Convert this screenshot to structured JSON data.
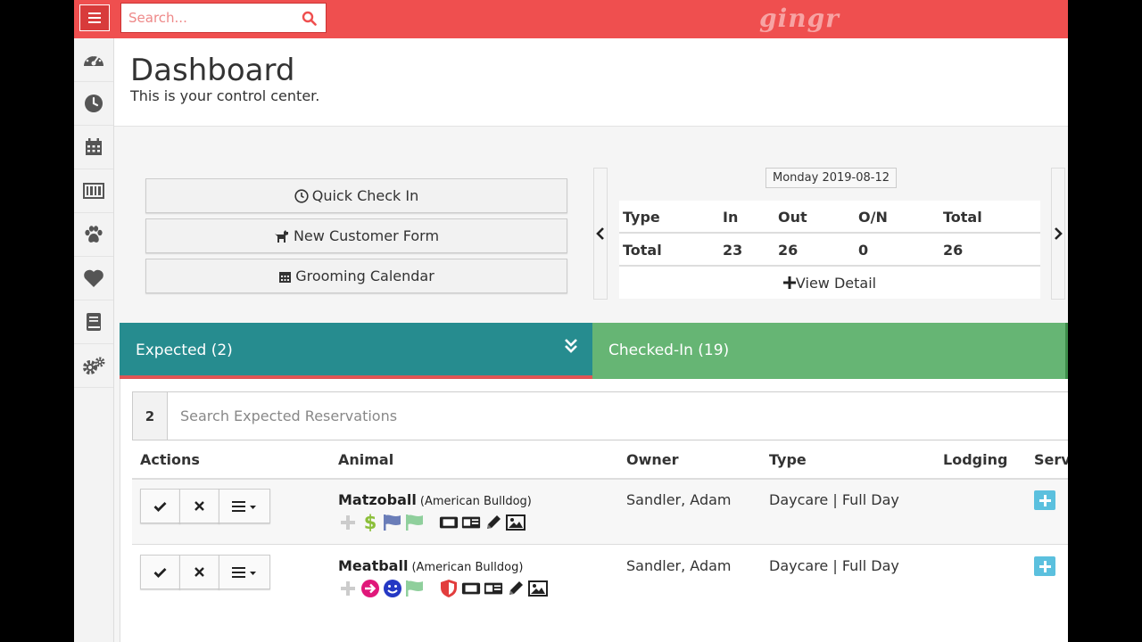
{
  "topbar": {
    "search_placeholder": "Search...",
    "logo": "gingr"
  },
  "sidebar": {
    "items": [
      {
        "icon": "dashboard-icon"
      },
      {
        "icon": "clock-icon"
      },
      {
        "icon": "calendar-icon"
      },
      {
        "icon": "barcode-icon"
      },
      {
        "icon": "paw-icon"
      },
      {
        "icon": "heart-icon"
      },
      {
        "icon": "book-icon"
      },
      {
        "icon": "gears-icon"
      }
    ]
  },
  "header": {
    "title": "Dashboard",
    "subtitle": "This is your control center."
  },
  "quick_actions": {
    "check_in": "Quick Check In",
    "customer_form": "New Customer Form",
    "grooming": "Grooming Calendar"
  },
  "summary": {
    "date": "Monday 2019-08-12",
    "columns": [
      "Type",
      "In",
      "Out",
      "O/N",
      "Total"
    ],
    "row": [
      "Total",
      "23",
      "26",
      "0",
      "26"
    ],
    "view_detail": "View Detail"
  },
  "tabs": {
    "expected": "Expected (2)",
    "checked_in": "Checked-In (19)"
  },
  "expected": {
    "count": "2",
    "search_placeholder": "Search Expected Reservations",
    "columns": {
      "actions": "Actions",
      "animal": "Animal",
      "owner": "Owner",
      "type": "Type",
      "lodging": "Lodging",
      "services": "Servi"
    },
    "rows": [
      {
        "name": "Matzoball",
        "breed": "(American Bulldog)",
        "owner": "Sandler, Adam",
        "type": "Daycare | Full Day",
        "lodging": ""
      },
      {
        "name": "Meatball",
        "breed": "(American Bulldog)",
        "owner": "Sandler, Adam",
        "type": "Daycare | Full Day",
        "lodging": ""
      }
    ]
  },
  "colors": {
    "brand_red": "#ef4f4f",
    "expected_teal": "#268c8f",
    "checked_green": "#66b574",
    "info_blue": "#5bc0de"
  }
}
